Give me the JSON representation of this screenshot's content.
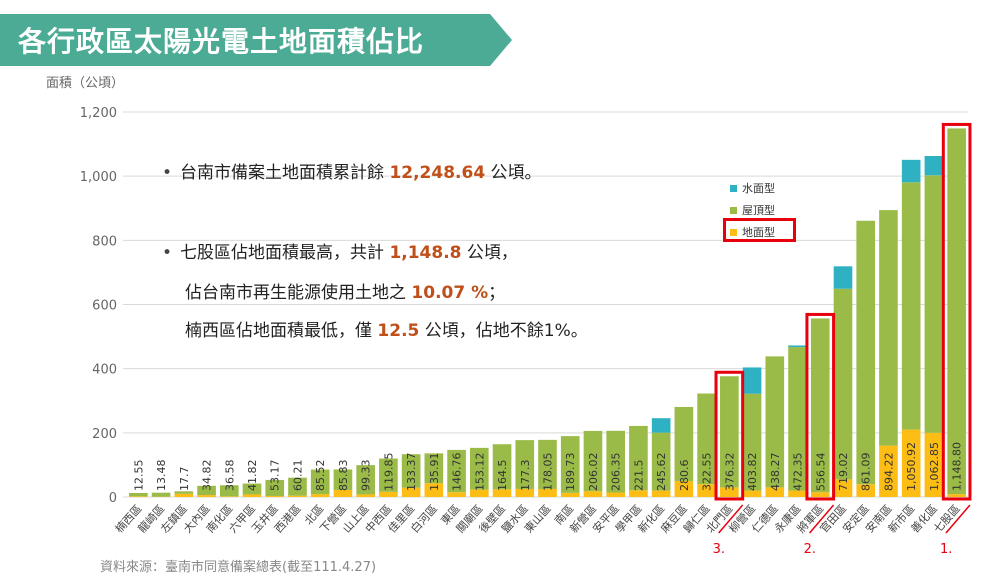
{
  "header": {
    "title": "各行政區太陽光電土地面積佔比",
    "banner_color": "#4cab94"
  },
  "notes": {
    "line1_prefix": "台南市備案土地面積累計餘 ",
    "line1_value": "12,248.64",
    "line1_suffix": " 公頃。",
    "line2_prefix": "七股區佔地面積最高，共計 ",
    "line2_value": "1,148.8",
    "line2_suffix": " 公頃，",
    "line3_prefix": "佔台南市再生能源使用土地之 ",
    "line3_value": "10.07 %",
    "line3_suffix": "；",
    "line4_prefix": "楠西區佔地面積最低，僅 ",
    "line4_value": "12.5",
    "line4_suffix": " 公頃，佔地不餘1%。"
  },
  "source": "資料來源：臺南市同意備案總表(截至111.4.27)",
  "chart_data": {
    "type": "bar",
    "stacked": true,
    "ylabel": "面積（公頃）",
    "ylim": [
      0,
      1200
    ],
    "yticks": [
      "0",
      "200",
      "400",
      "600",
      "800",
      "1,000",
      "1,200"
    ],
    "grid": true,
    "legend_placement": "upper-right",
    "categories": [
      "楠西區",
      "龍崎區",
      "左鎮區",
      "大內區",
      "南化區",
      "六甲區",
      "玉井區",
      "西港區",
      "北區",
      "下營區",
      "山上區",
      "中西區",
      "佳里區",
      "白河區",
      "東區",
      "關廟區",
      "後壁區",
      "鹽水區",
      "東山區",
      "南區",
      "新營區",
      "安平區",
      "學甲區",
      "新化區",
      "麻豆區",
      "歸仁區",
      "北門區",
      "柳營區",
      "仁德區",
      "永康區",
      "將軍區",
      "官田區",
      "安定區",
      "安南區",
      "新市區",
      "善化區",
      "七股區"
    ],
    "labels": [
      "12.55",
      "13.48",
      "17.7",
      "34.82",
      "36.58",
      "41.82",
      "53.17",
      "60.21",
      "85.52",
      "85.83",
      "99.33",
      "119.85",
      "133.37",
      "135.91",
      "146.76",
      "153.12",
      "164.5",
      "177.3",
      "178.05",
      "189.73",
      "206.02",
      "206.35",
      "221.5",
      "245.62",
      "280.6",
      "322.55",
      "376.32",
      "403.82",
      "438.27",
      "472.35",
      "556.54",
      "719.02",
      "861.09",
      "894.22",
      "1,050.92",
      "1,062.85",
      "1,148.80"
    ],
    "series": [
      {
        "name": "水面型",
        "color": "#2eb1c3",
        "values": [
          0,
          0,
          0,
          0,
          0,
          0,
          0,
          0,
          0,
          0,
          0,
          0,
          0,
          0,
          0,
          0,
          0,
          0,
          0,
          0,
          0,
          0,
          0,
          45,
          0,
          0,
          0,
          82,
          0,
          5,
          0,
          70,
          0,
          0,
          70,
          60,
          0
        ]
      },
      {
        "name": "屋頂型",
        "color": "#9bbb49",
        "values": [
          10.55,
          12.48,
          7.7,
          28.82,
          34.58,
          33.82,
          50.17,
          56.21,
          76.52,
          63.83,
          91.33,
          103.85,
          104.37,
          92.91,
          131.76,
          130.12,
          140.5,
          152.3,
          153.05,
          176.73,
          188.02,
          192.35,
          200.5,
          180.62,
          230.6,
          282.55,
          346.32,
          301.82,
          408.27,
          447.35,
          541.54,
          594.02,
          821.09,
          734.22,
          770.92,
          802.85,
          1139.8
        ]
      },
      {
        "name": "地面型",
        "color": "#fcbd15",
        "values": [
          2,
          1,
          10,
          6,
          2,
          8,
          3,
          4,
          9,
          22,
          8,
          16,
          29,
          43,
          15,
          23,
          24,
          25,
          25,
          13,
          18,
          14,
          21,
          20,
          50,
          40,
          30,
          20,
          30,
          20,
          15,
          55,
          40,
          160,
          210,
          200,
          9
        ]
      }
    ],
    "highlighted": [
      {
        "category": "北門區",
        "rank": "3."
      },
      {
        "category": "將軍區",
        "rank": "2."
      },
      {
        "category": "七股區",
        "rank": "1."
      }
    ],
    "highlight_color": "#e8000d"
  }
}
